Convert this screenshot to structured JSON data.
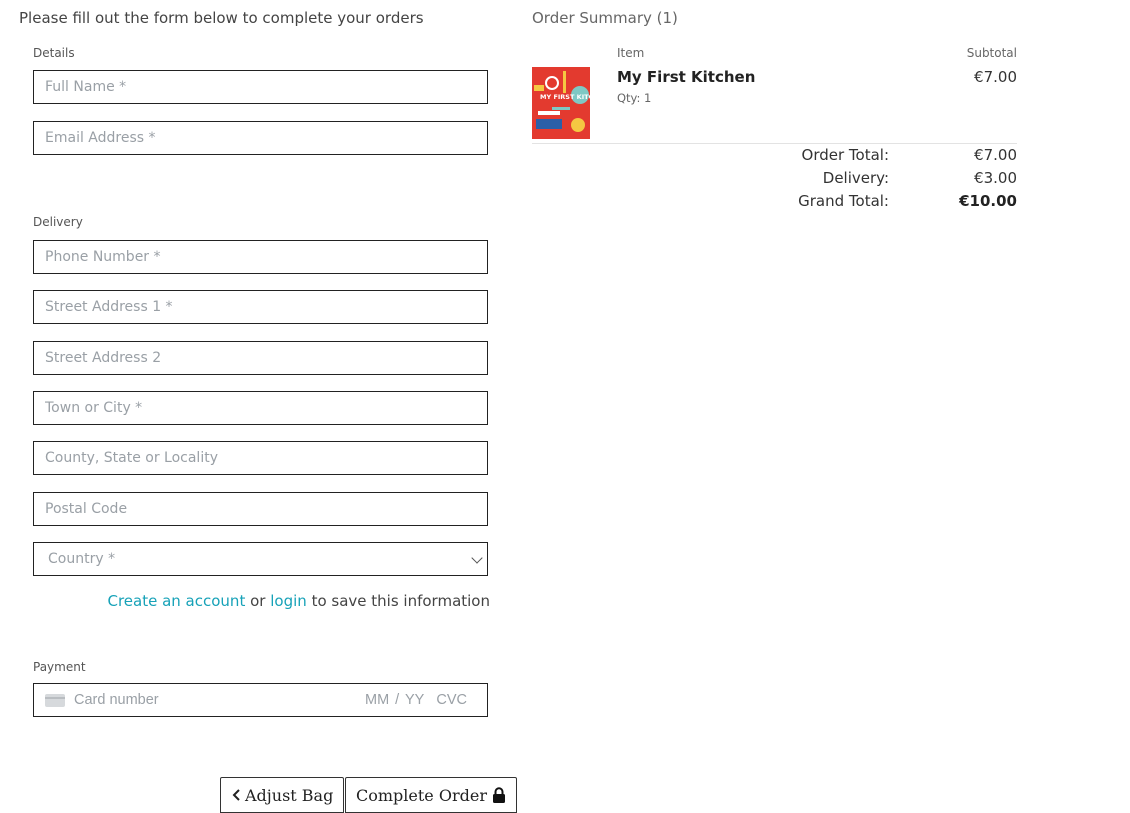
{
  "intro": "Please fill out the form below to complete your orders",
  "details": {
    "label": "Details",
    "full_name": "Full Name *",
    "email": "Email Address *"
  },
  "delivery": {
    "label": "Delivery",
    "phone": "Phone Number *",
    "street1": "Street Address 1 *",
    "street2": "Street Address 2",
    "town": "Town or City *",
    "county": "County, State or Locality",
    "postal": "Postal Code",
    "country": "Country *"
  },
  "save": {
    "create_account": "Create an account",
    "or": "or",
    "login": "login",
    "suffix": "to save this information"
  },
  "payment": {
    "label": "Payment",
    "card_number": "Card number",
    "expiry": "MM / YY",
    "cvc": "CVC"
  },
  "buttons": {
    "adjust_bag": "Adjust Bag",
    "complete_order": "Complete Order"
  },
  "summary": {
    "title": "Order Summary (1)",
    "col_item": "Item",
    "col_subtotal": "Subtotal",
    "item": {
      "name": "My First Kitchen",
      "qty": "Qty: 1",
      "subtotal": "€7.00",
      "cover_text": "MY FIRST KITCHEN"
    },
    "order_total_label": "Order Total:",
    "order_total": "€7.00",
    "delivery_label": "Delivery:",
    "delivery": "€3.00",
    "grand_total_label": "Grand Total:",
    "grand_total": "€10.00"
  },
  "icons": {
    "back": "chevron-left-icon",
    "lock": "lock-icon",
    "card": "credit-card-icon",
    "dropdown": "chevron-down-icon"
  },
  "colors": {
    "link": "#17a2b8",
    "cover": "#e33a2f"
  }
}
